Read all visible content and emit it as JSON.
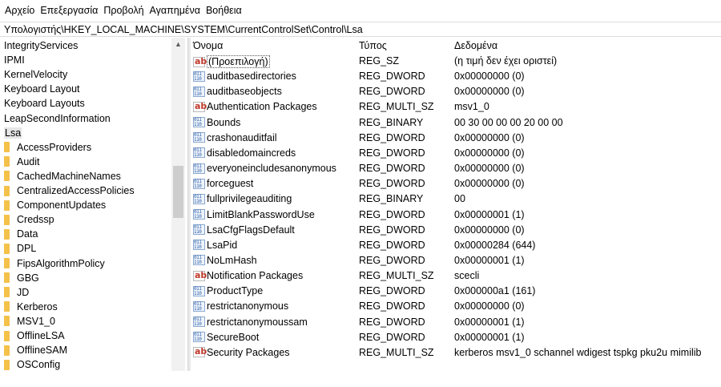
{
  "menu": [
    "Αρχείο",
    "Επεξεργασία",
    "Προβολή",
    "Αγαπημένα",
    "Βοήθεια"
  ],
  "address": "Υπολογιστής\\HKEY_LOCAL_MACHINE\\SYSTEM\\CurrentControlSet\\Control\\Lsa",
  "tree": {
    "top_items": [
      "IntegrityServices",
      "IPMI",
      "KernelVelocity",
      "Keyboard Layout",
      "Keyboard Layouts",
      "LeapSecondInformation",
      "Lsa"
    ],
    "selected": "Lsa",
    "children": [
      "AccessProviders",
      "Audit",
      "CachedMachineNames",
      "CentralizedAccessPolicies",
      "ComponentUpdates",
      "Credssp",
      "Data",
      "DPL",
      "FipsAlgorithmPolicy",
      "GBG",
      "JD",
      "Kerberos",
      "MSV1_0",
      "OfflineLSA",
      "OfflineSAM",
      "OSConfig"
    ]
  },
  "columns": {
    "name": "Όνομα",
    "type": "Τύπος",
    "data": "Δεδομένα"
  },
  "values": [
    {
      "icon": "string-value-icon",
      "name": "(Προεπιλογή)",
      "type": "REG_SZ",
      "data": "(η τιμή δεν έχει οριστεί)"
    },
    {
      "icon": "binary-value-icon",
      "name": "auditbasedirectories",
      "type": "REG_DWORD",
      "data": "0x00000000 (0)"
    },
    {
      "icon": "binary-value-icon",
      "name": "auditbaseobjects",
      "type": "REG_DWORD",
      "data": "0x00000000 (0)"
    },
    {
      "icon": "string-value-icon",
      "name": "Authentication Packages",
      "type": "REG_MULTI_SZ",
      "data": "msv1_0"
    },
    {
      "icon": "binary-value-icon",
      "name": "Bounds",
      "type": "REG_BINARY",
      "data": "00 30 00 00 00 20 00 00"
    },
    {
      "icon": "binary-value-icon",
      "name": "crashonauditfail",
      "type": "REG_DWORD",
      "data": "0x00000000 (0)"
    },
    {
      "icon": "binary-value-icon",
      "name": "disabledomaincreds",
      "type": "REG_DWORD",
      "data": "0x00000000 (0)"
    },
    {
      "icon": "binary-value-icon",
      "name": "everyoneincludesanonymous",
      "type": "REG_DWORD",
      "data": "0x00000000 (0)"
    },
    {
      "icon": "binary-value-icon",
      "name": "forceguest",
      "type": "REG_DWORD",
      "data": "0x00000000 (0)"
    },
    {
      "icon": "binary-value-icon",
      "name": "fullprivilegeauditing",
      "type": "REG_BINARY",
      "data": "00"
    },
    {
      "icon": "binary-value-icon",
      "name": "LimitBlankPasswordUse",
      "type": "REG_DWORD",
      "data": "0x00000001 (1)"
    },
    {
      "icon": "binary-value-icon",
      "name": "LsaCfgFlagsDefault",
      "type": "REG_DWORD",
      "data": "0x00000000 (0)"
    },
    {
      "icon": "binary-value-icon",
      "name": "LsaPid",
      "type": "REG_DWORD",
      "data": "0x00000284 (644)"
    },
    {
      "icon": "binary-value-icon",
      "name": "NoLmHash",
      "type": "REG_DWORD",
      "data": "0x00000001 (1)"
    },
    {
      "icon": "string-value-icon",
      "name": "Notification Packages",
      "type": "REG_MULTI_SZ",
      "data": "scecli"
    },
    {
      "icon": "binary-value-icon",
      "name": "ProductType",
      "type": "REG_DWORD",
      "data": "0x000000a1 (161)"
    },
    {
      "icon": "binary-value-icon",
      "name": "restrictanonymous",
      "type": "REG_DWORD",
      "data": "0x00000000 (0)"
    },
    {
      "icon": "binary-value-icon",
      "name": "restrictanonymoussam",
      "type": "REG_DWORD",
      "data": "0x00000001 (1)"
    },
    {
      "icon": "binary-value-icon",
      "name": "SecureBoot",
      "type": "REG_DWORD",
      "data": "0x00000001 (1)"
    },
    {
      "icon": "string-value-icon",
      "name": "Security Packages",
      "type": "REG_MULTI_SZ",
      "data": "kerberos msv1_0 schannel wdigest tspkg pku2u mimilib"
    }
  ],
  "selected_value": "(Προεπιλογή)",
  "colors": {
    "folder": "#f4c14a",
    "selection": "#e5e5e5",
    "string_icon": "#c0392b",
    "binary_icon": "#2e5ea8"
  }
}
